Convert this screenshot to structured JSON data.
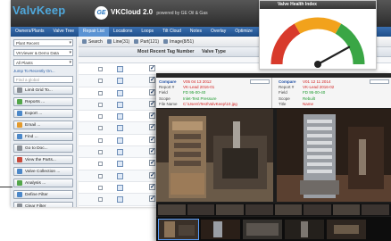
{
  "header": {
    "logo": "ValvKeep",
    "ge_badge": "GE",
    "title": "VKCloud 2.0",
    "subtitle": "powered by GE Oil & Gas"
  },
  "menu": [
    "Owners/Plants",
    "Valve Tree",
    "Repair List",
    "Locations",
    "Loops",
    "Tilt Cloud",
    "Notes",
    "Overlay",
    "Optimize"
  ],
  "menu_active": 2,
  "sidebar": {
    "plant_select": "Plant Recent",
    "user_select": "VKViewer & Demo Data",
    "area_select": "All Plants",
    "jump_link": "Jump To Recently On...",
    "search_placeholder": "Find a global",
    "buttons": [
      {
        "label": "Limit Grid To...",
        "icon": "filter-icon",
        "tone": "gray"
      },
      {
        "label": "Reports ...",
        "icon": "report-icon",
        "tone": "green"
      },
      {
        "label": "Export ...",
        "icon": "export-icon",
        "tone": "blue"
      },
      {
        "label": "Email ...",
        "icon": "email-icon",
        "tone": "orange"
      },
      {
        "label": "Find ...",
        "icon": "find-icon",
        "tone": "blue"
      },
      {
        "label": "Go to Doc...",
        "icon": "doc-icon",
        "tone": "gray"
      },
      {
        "label": "View the Parts...",
        "icon": "parts-icon",
        "tone": "red"
      },
      {
        "label": "Valve Collection ...",
        "icon": "valve-icon",
        "tone": "blue"
      },
      {
        "label": "Analysis ...",
        "icon": "analysis-icon",
        "tone": "green"
      },
      {
        "label": "Define Filter",
        "icon": "filter-icon",
        "tone": "blue"
      },
      {
        "label": "Clear Filter",
        "icon": "clear-icon",
        "tone": "gray"
      }
    ]
  },
  "grid": {
    "toolbar": [
      {
        "label": "Search",
        "icon": "search-icon"
      },
      {
        "label": "Line(31)",
        "icon": "line-icon"
      },
      {
        "label": "Part(121)",
        "icon": "part-icon"
      },
      {
        "label": "Image(8/51)",
        "icon": "image-icon"
      }
    ],
    "columns": [
      "Most Recent Tag Number",
      "Valve Type",
      "Se"
    ],
    "row_count": 12
  },
  "health": {
    "title": "Valve Health Index",
    "value_fraction": 0.84
  },
  "viewer": {
    "left": {
      "lines": [
        {
          "k": "Compare",
          "v": "V05 04 13 2012"
        },
        {
          "k": "Report #",
          "v": "VK-Lead 2016-01"
        },
        {
          "k": "Field",
          "v": "FD 95-00-40"
        },
        {
          "k": "Scope",
          "v": "Inlet-Test Pressure"
        },
        {
          "k": "File Name",
          "v": "C:\\Users\\Test\\ValvKeep\\10.jpg"
        }
      ]
    },
    "right": {
      "lines": [
        {
          "k": "Compare",
          "v": "V01 12 11 2014"
        },
        {
          "k": "Report #",
          "v": "VK-Lead 2016-02"
        },
        {
          "k": "Field",
          "v": "FD 95-00-40"
        },
        {
          "k": "Scope",
          "v": "Rebuilt"
        },
        {
          "k": "Title",
          "v": "Name"
        }
      ]
    }
  },
  "colors": {
    "brand": "#4fa8dc",
    "menubar": "#1f4f8a",
    "gauge_red": "#d83a2b",
    "gauge_amber": "#f2a21c",
    "gauge_green": "#3aa645"
  }
}
